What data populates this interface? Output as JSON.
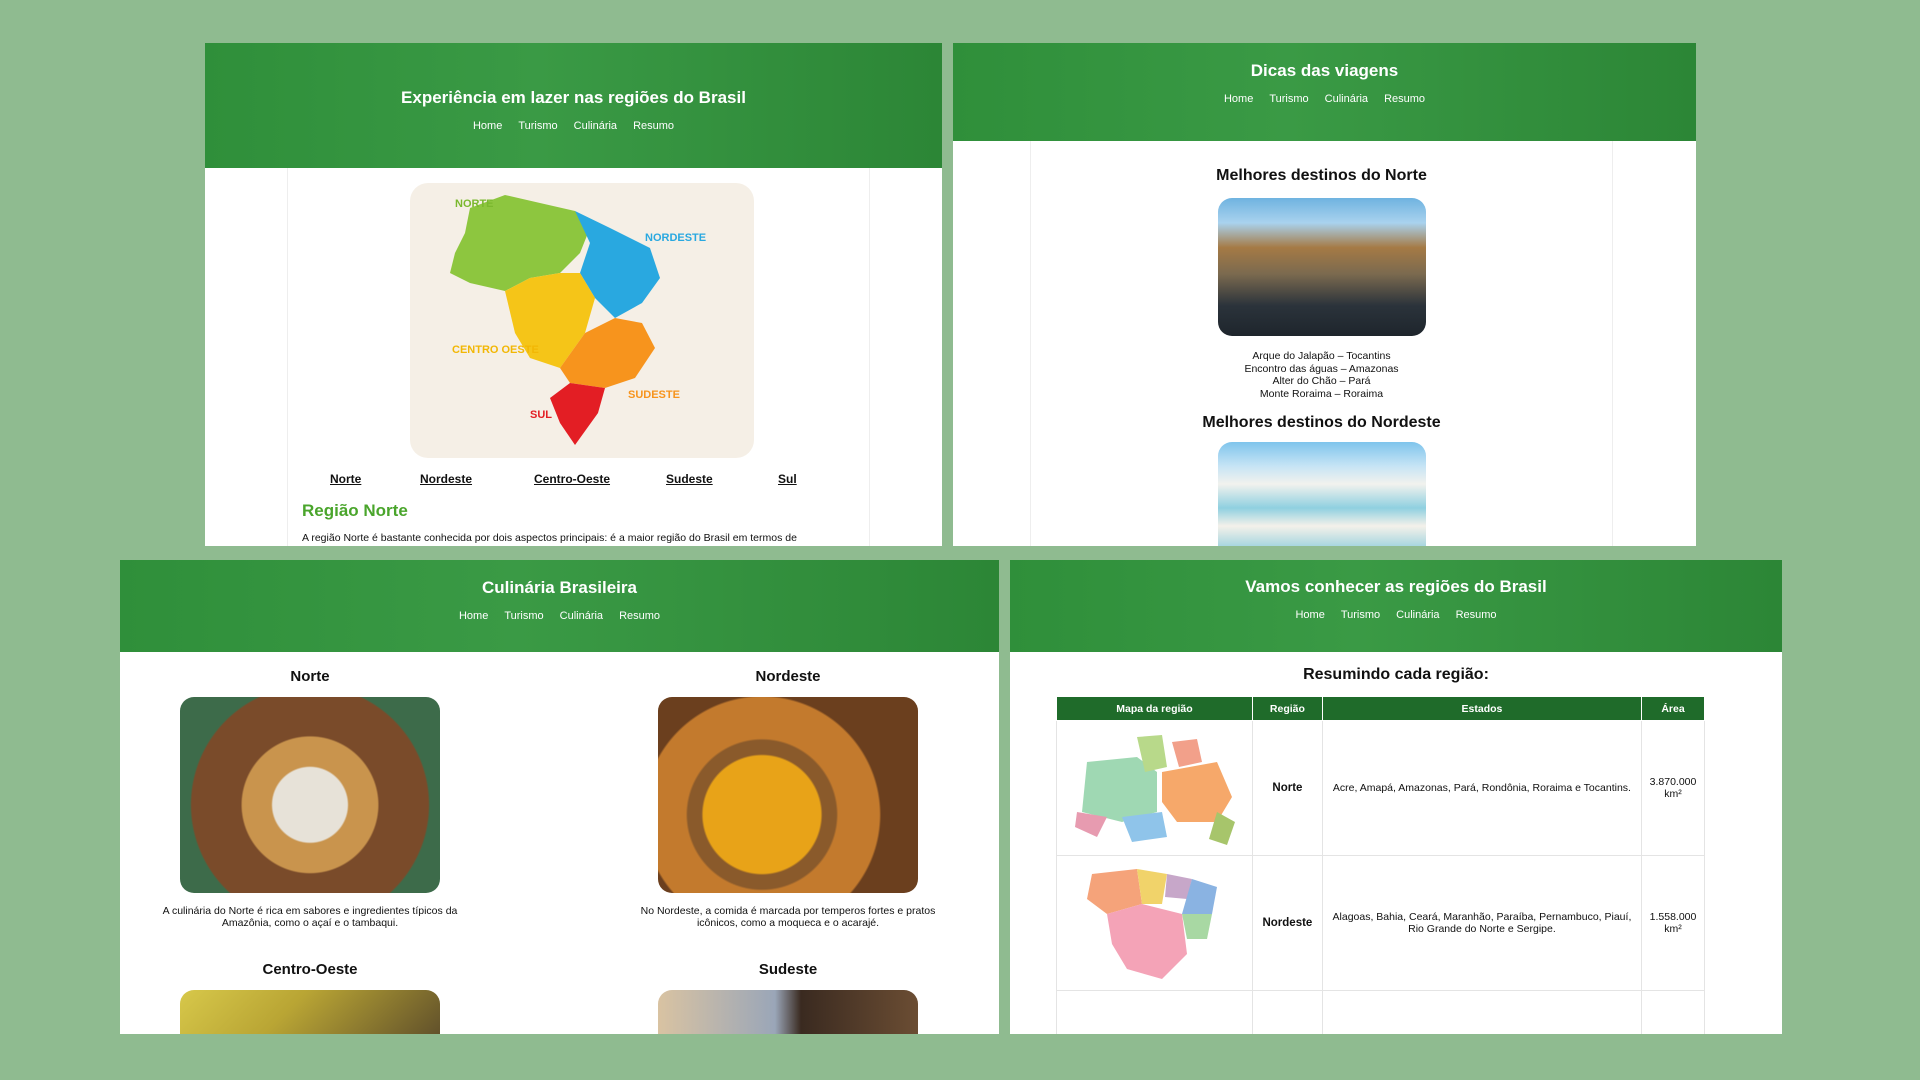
{
  "nav": {
    "home": "Home",
    "turismo": "Turismo",
    "culinaria": "Culinária",
    "resumo": "Resumo"
  },
  "panel1": {
    "title": "Experiência em lazer nas regiões do Brasil",
    "map_labels": {
      "norte": "NORTE",
      "nordeste": "NORDESTE",
      "centro_oeste": "CENTRO OESTE",
      "sudeste": "SUDESTE",
      "sul": "SUL"
    },
    "region_links": [
      "Norte",
      "Nordeste",
      "Centro-Oeste",
      "Sudeste",
      "Sul"
    ],
    "region_title": "Região Norte",
    "region_text": "A região Norte é bastante conhecida por dois aspectos principais: é a maior região do Brasil em termos de"
  },
  "panel2": {
    "title": "Dicas das viagens",
    "norte_title": "Melhores destinos do Norte",
    "norte_list": [
      "Arque do Jalapão – Tocantins",
      "Encontro das águas – Amazonas",
      "Alter do Chão – Pará",
      "Monte Roraima – Roraima"
    ],
    "nordeste_title": "Melhores destinos do Nordeste"
  },
  "panel3": {
    "title": "Culinária Brasileira",
    "norte": {
      "title": "Norte",
      "text": "A culinária do Norte é rica em sabores e ingredientes típicos da Amazônia, como o açaí e o tambaqui."
    },
    "nordeste": {
      "title": "Nordeste",
      "text": "No Nordeste, a comida é marcada por temperos fortes e pratos icônicos, como a moqueca e o acarajé."
    },
    "centro_oeste": {
      "title": "Centro-Oeste"
    },
    "sudeste": {
      "title": "Sudeste"
    }
  },
  "panel4": {
    "title": "Vamos conhecer as regiões do Brasil",
    "table_title": "Resumindo cada região:",
    "headers": [
      "Mapa da região",
      "Região",
      "Estados",
      "Área"
    ],
    "rows": [
      {
        "region": "Norte",
        "states": "Acre, Amapá, Amazonas, Pará, Rondônia, Roraima e Tocantins.",
        "area": "3.870.000 km²"
      },
      {
        "region": "Nordeste",
        "states": "Alagoas, Bahia, Ceará, Maranhão, Paraíba, Pernambuco, Piauí, Rio Grande do Norte e Sergipe.",
        "area": "1.558.000 km²"
      }
    ]
  },
  "colors": {
    "header_green": "#2f8f3a",
    "table_header": "#1f6b2a",
    "region_title": "#4aa52c",
    "background": "#8fbb90"
  }
}
